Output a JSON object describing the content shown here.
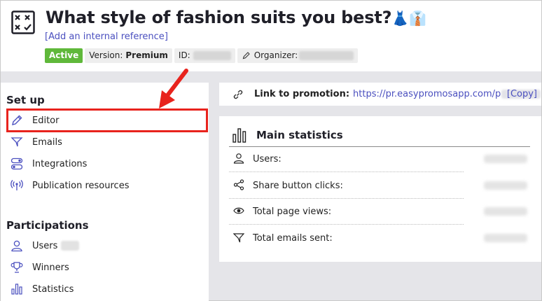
{
  "header": {
    "title": "What style of fashion suits you best?",
    "title_emoji": "👗👔",
    "reference_link_open": "[",
    "reference_link": "Add an internal reference",
    "reference_link_close": "]",
    "badges": {
      "status": "Active",
      "version_label": "Version:",
      "version_value": "Premium",
      "id_label": "ID:",
      "organizer_label": "Organizer:"
    }
  },
  "sidebar": {
    "setup_title": "Set up",
    "setup_items": [
      {
        "label": "Editor",
        "icon": "pencil-icon"
      },
      {
        "label": "Emails",
        "icon": "send-icon"
      },
      {
        "label": "Integrations",
        "icon": "toggles-icon"
      },
      {
        "label": "Publication resources",
        "icon": "broadcast-icon"
      }
    ],
    "participations_title": "Participations",
    "participation_items": [
      {
        "label": "Users",
        "icon": "user-icon"
      },
      {
        "label": "Winners",
        "icon": "trophy-icon"
      },
      {
        "label": "Statistics",
        "icon": "bar-chart-icon"
      }
    ]
  },
  "promotion": {
    "label": "Link to promotion:",
    "url": "https://pr.easypromosapp.com/p",
    "copy_label": "[Copy]"
  },
  "statistics": {
    "title": "Main statistics",
    "rows": [
      {
        "label": "Users:",
        "icon": "user-icon"
      },
      {
        "label": "Share button clicks:",
        "icon": "share-icon"
      },
      {
        "label": "Total page views:",
        "icon": "eye-icon"
      },
      {
        "label": "Total emails sent:",
        "icon": "send-icon"
      }
    ]
  },
  "colors": {
    "accent": "#4a4fbf",
    "active_badge": "#5fb83a",
    "highlight": "#e8231d"
  }
}
